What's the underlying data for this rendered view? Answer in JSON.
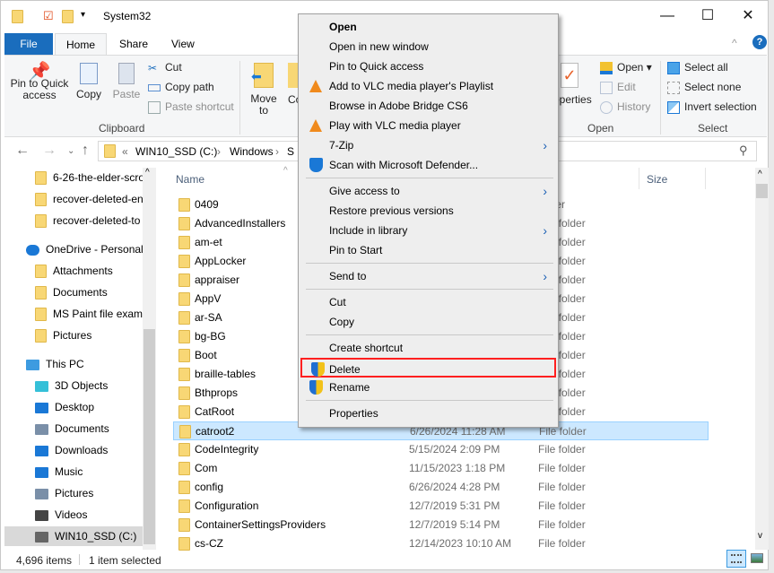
{
  "window": {
    "title": "System32",
    "minimize": "—",
    "maximize": "☐",
    "close": "✕"
  },
  "tabs": [
    "File",
    "Home",
    "Share",
    "View"
  ],
  "ribbon": {
    "clipboard": {
      "pin": "Pin to Quick access",
      "copy": "Copy",
      "paste": "Paste",
      "cut": "Cut",
      "copy_path": "Copy path",
      "paste_shortcut": "Paste shortcut",
      "label": "Clipboard"
    },
    "organize": {
      "move_to": "Move to",
      "copy_to": "Co to"
    },
    "open": {
      "properties": "operties",
      "open": "Open",
      "edit": "Edit",
      "history": "History",
      "label": "Open"
    },
    "select": {
      "select_all": "Select all",
      "select_none": "Select none",
      "invert": "Invert selection",
      "label": "Select"
    }
  },
  "address": {
    "path": [
      "WIN10_SSD (C:)",
      "Windows",
      "S"
    ],
    "overflow": "«"
  },
  "nav": [
    {
      "label": "6-26-the-elder-scro",
      "type": "folder"
    },
    {
      "label": "recover-deleted-en",
      "type": "folder"
    },
    {
      "label": "recover-deleted-to",
      "type": "folder"
    },
    {
      "label": "OneDrive - Personal",
      "type": "onedrive"
    },
    {
      "label": "Attachments",
      "type": "folder"
    },
    {
      "label": "Documents",
      "type": "folder"
    },
    {
      "label": "MS Paint file examp",
      "type": "folder"
    },
    {
      "label": "Pictures",
      "type": "folder"
    },
    {
      "label": "This PC",
      "type": "pc"
    },
    {
      "label": "3D Objects",
      "type": "3d"
    },
    {
      "label": "Desktop",
      "type": "desktop"
    },
    {
      "label": "Documents",
      "type": "docs"
    },
    {
      "label": "Downloads",
      "type": "downloads"
    },
    {
      "label": "Music",
      "type": "music"
    },
    {
      "label": "Pictures",
      "type": "pictures"
    },
    {
      "label": "Videos",
      "type": "videos"
    },
    {
      "label": "WIN10_SSD (C:)",
      "type": "drive",
      "selected": true
    }
  ],
  "columns": {
    "name": "Name",
    "size": "Size"
  },
  "files": [
    {
      "name": "0409",
      "date": "",
      "type": "folder"
    },
    {
      "name": "AdvancedInstallers",
      "date": "",
      "type": "File folder"
    },
    {
      "name": "am-et",
      "date": "",
      "type": "File folder"
    },
    {
      "name": "AppLocker",
      "date": "",
      "type": "File folder"
    },
    {
      "name": "appraiser",
      "date": "",
      "type": "File folder"
    },
    {
      "name": "AppV",
      "date": "",
      "type": "File folder"
    },
    {
      "name": "ar-SA",
      "date": "",
      "type": "File folder"
    },
    {
      "name": "bg-BG",
      "date": "",
      "type": "File folder"
    },
    {
      "name": "Boot",
      "date": "",
      "type": "File folder"
    },
    {
      "name": "braille-tables",
      "date": "",
      "type": "File folder"
    },
    {
      "name": "Bthprops",
      "date": "",
      "type": "File folder"
    },
    {
      "name": "CatRoot",
      "date": "",
      "type": "File folder"
    },
    {
      "name": "catroot2",
      "date": "6/26/2024 11:28 AM",
      "type": "File folder",
      "selected": true
    },
    {
      "name": "CodeIntegrity",
      "date": "5/15/2024 2:09 PM",
      "type": "File folder"
    },
    {
      "name": "Com",
      "date": "11/15/2023 1:18 PM",
      "type": "File folder"
    },
    {
      "name": "config",
      "date": "6/26/2024 4:28 PM",
      "type": "File folder"
    },
    {
      "name": "Configuration",
      "date": "12/7/2019 5:31 PM",
      "type": "File folder"
    },
    {
      "name": "ContainerSettingsProviders",
      "date": "12/7/2019 5:14 PM",
      "type": "File folder"
    },
    {
      "name": "cs-CZ",
      "date": "12/14/2023 10:10 AM",
      "type": "File folder"
    }
  ],
  "status": {
    "count": "4,696 items",
    "selected": "1 item selected"
  },
  "context_menu": [
    {
      "label": "Open",
      "bold": true
    },
    {
      "label": "Open in new window"
    },
    {
      "label": "Pin to Quick access"
    },
    {
      "label": "Add to VLC media player's Playlist",
      "icon": "vlc"
    },
    {
      "label": "Browse in Adobe Bridge CS6"
    },
    {
      "label": "Play with VLC media player",
      "icon": "vlc"
    },
    {
      "label": "7-Zip",
      "submenu": true
    },
    {
      "label": "Scan with Microsoft Defender...",
      "icon": "defender"
    },
    {
      "sep": true
    },
    {
      "label": "Give access to",
      "submenu": true
    },
    {
      "label": "Restore previous versions"
    },
    {
      "label": "Include in library",
      "submenu": true
    },
    {
      "label": "Pin to Start"
    },
    {
      "sep": true
    },
    {
      "label": "Send to",
      "submenu": true
    },
    {
      "sep": true
    },
    {
      "label": "Cut"
    },
    {
      "label": "Copy"
    },
    {
      "sep": true
    },
    {
      "label": "Create shortcut"
    },
    {
      "label": "Delete",
      "icon": "uac-shield",
      "highlighted": true
    },
    {
      "label": "Rename",
      "icon": "uac-shield"
    },
    {
      "sep": true
    },
    {
      "label": "Properties"
    }
  ],
  "colors": {
    "accent": "#1a6dbd",
    "selection": "#cce8ff",
    "highlight_box": "#ff1f1f"
  }
}
